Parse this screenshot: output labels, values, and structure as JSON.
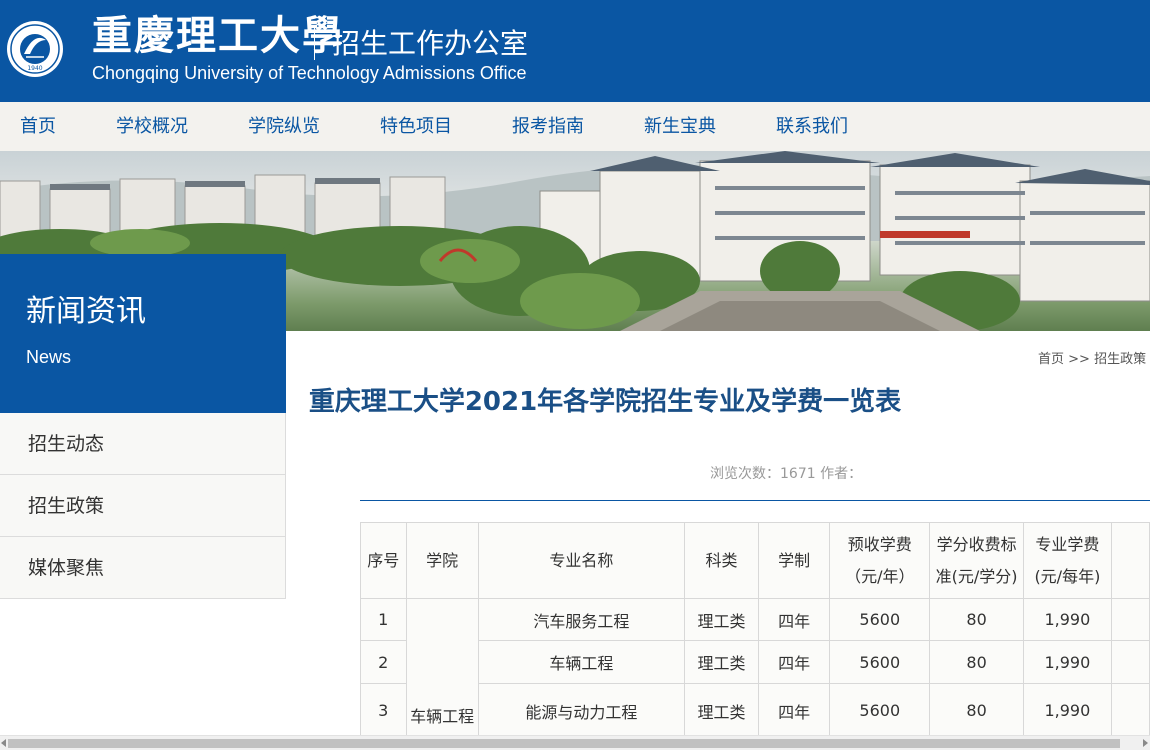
{
  "header": {
    "brand_cn": "重慶理工大學",
    "office": "招生工作办公室",
    "brand_en": "Chongqing University of Technology Admissions Office",
    "logo_year": "1940"
  },
  "nav": {
    "items": [
      "首页",
      "学校概况",
      "学院纵览",
      "特色项目",
      "报考指南",
      "新生宝典",
      "联系我们"
    ]
  },
  "sidebar": {
    "title": "新闻资讯",
    "subtitle": "News",
    "items": [
      "招生动态",
      "招生政策",
      "媒体聚焦"
    ]
  },
  "breadcrumb": {
    "home": "首页",
    "sep": ">>",
    "current": "招生政策"
  },
  "article": {
    "title": "重庆理工大学2021年各学院招生专业及学费一览表",
    "meta": "浏览次数：1671 作者："
  },
  "table": {
    "headers": {
      "no": "序号",
      "college": "学院",
      "major": "专业名称",
      "category": "科类",
      "duration": "学制",
      "fee_line1": "预收学费",
      "fee_line2": "（元/年）",
      "credit_line1": "学分收费标",
      "credit_line2": "准(元/学分)",
      "major_fee_line1": "专业学费",
      "major_fee_line2": "(元/每年)"
    },
    "college": "车辆工程",
    "rows": [
      {
        "no": "1",
        "major": "汽车服务工程",
        "category": "理工类",
        "duration": "四年",
        "fee": "5600",
        "credit": "80",
        "major_fee": "1,990"
      },
      {
        "no": "2",
        "major": "车辆工程",
        "category": "理工类",
        "duration": "四年",
        "fee": "5600",
        "credit": "80",
        "major_fee": "1,990"
      },
      {
        "no": "3",
        "major": "能源与动力工程",
        "category": "理工类",
        "duration": "四年",
        "fee": "5600",
        "credit": "80",
        "major_fee": "1,990"
      }
    ]
  },
  "colors": {
    "brand_blue": "#0a56a3",
    "title_blue": "#1a4f86",
    "nav_bg": "#f3f2ee"
  }
}
